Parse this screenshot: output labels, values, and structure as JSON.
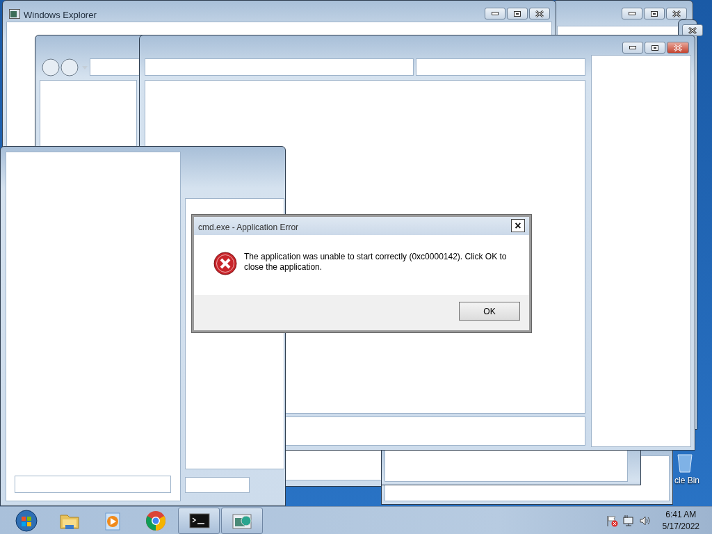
{
  "explorer_window": {
    "title": "Windows Explorer"
  },
  "dialog": {
    "title": "cmd.exe - Application Error",
    "close": "×",
    "message": "The application was unable to start correctly (0xc0000142). Click OK to close the application.",
    "buttons": [
      "OK"
    ]
  },
  "desktop_icons": [
    {
      "label": "cle Bin"
    }
  ],
  "taskbar": {
    "items": [
      {
        "kind": "start",
        "running": false
      },
      {
        "kind": "folder",
        "running": false
      },
      {
        "kind": "media",
        "running": false
      },
      {
        "kind": "browser",
        "running": false
      },
      {
        "kind": "console",
        "running": true
      },
      {
        "kind": "app",
        "running": true
      }
    ],
    "clock": {
      "time": "6:41 AM",
      "date": "5/17/2022"
    }
  }
}
